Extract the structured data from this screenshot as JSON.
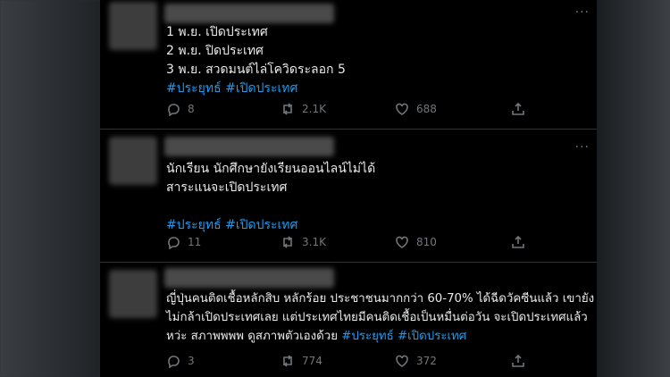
{
  "tweets": [
    {
      "lines": [
        "1 พ.ย. เปิดประเทศ",
        "2 พ.ย.  ปิดประเทศ",
        "3 พ.ย. สวดมนต์ไล่โควิดระลอก 5"
      ],
      "hashtags": "#ประยุทธ์ #เปิดประเทศ",
      "replies": "8",
      "retweets": "2.1K",
      "likes": "688"
    },
    {
      "lines": [
        "นักเรียน นักศึกษายังเรียนออนไลน์ไม่ได้",
        "สาระแนจะเปิดประเทศ"
      ],
      "hashtags": "#ประยุทธ์ #เปิดประเทศ",
      "replies": "11",
      "retweets": "3.1K",
      "likes": "810"
    },
    {
      "lines": [
        "ญี่ปุ่นคนติดเชื้อหลักสิบ หลักร้อย ประชาชนมากกว่า 60-70% ได้ฉีดวัคซีนแล้ว เขายัง",
        "ไม่กล้าเปิดประเทศเลย แต่ประเทศไทยมีคนติดเชื้อเป็นหมื่นต่อวัน จะเปิดประเทศแล้ว"
      ],
      "last_line_text": "หว่ะ สภาพพพพ ดูสภาพตัวเองด้วย ",
      "hashtags": "#ประยุทธ์ #เปิดประเทศ",
      "replies": "3",
      "retweets": "774",
      "likes": "372"
    }
  ],
  "more_glyph": "···",
  "icons": [
    "reply-icon",
    "retweet-icon",
    "like-icon",
    "share-icon"
  ],
  "colors": {
    "background": "#000000",
    "text": "#e7e9ea",
    "hashtag": "#1d9bf0",
    "muted": "#71767b"
  }
}
